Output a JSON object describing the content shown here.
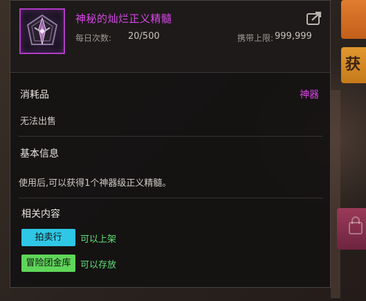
{
  "item": {
    "name": "神秘的灿烂正义精髓",
    "daily_label": "每日次数:",
    "daily_value": "20/500",
    "carry_label": "携带上限:",
    "carry_value": "999,999",
    "icon": "dark-crystal-emblem-icon",
    "frame_color": "#b13bc6"
  },
  "type_section": {
    "title": "消耗品",
    "grade": "神器",
    "trade_note": "无法出售"
  },
  "info_section": {
    "title": "基本信息",
    "description": "使用后,可以获得1个神器级正义精髓。"
  },
  "related_section": {
    "title": "相关内容",
    "items": [
      {
        "tag": "拍卖行",
        "note": "可以上架",
        "color": "#2fc7e6"
      },
      {
        "tag": "冒险团金库",
        "note": "可以存放",
        "color": "#5fd65a"
      }
    ]
  },
  "background": {
    "side_button": "获"
  },
  "colors": {
    "artifact_purple": "#d846e6",
    "note_green": "#5fe07a"
  }
}
